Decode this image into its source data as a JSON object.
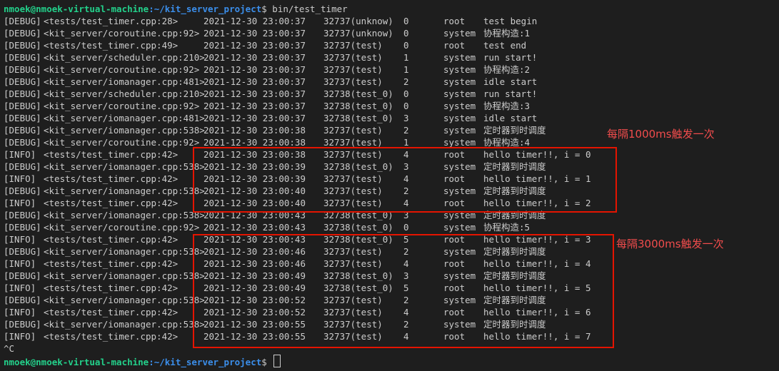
{
  "prompt_top": {
    "user_host": "nmoek@nmoek-virtual-machine",
    "path": ":~/kit_server_project",
    "command": "$ bin/test_timer"
  },
  "log_lines": [
    {
      "level": "[DEBUG]",
      "src": "<tests/test_timer.cpp:28>",
      "time": "2021-12-30 23:00:37",
      "thread": "32737(unknow)",
      "fiber": "0",
      "name": "root",
      "msg": "test begin"
    },
    {
      "level": "[DEBUG]",
      "src": "<kit_server/coroutine.cpp:92>",
      "time": "2021-12-30 23:00:37",
      "thread": "32737(unknow)",
      "fiber": "0",
      "name": "system",
      "msg": "协程构造:1"
    },
    {
      "level": "[DEBUG]",
      "src": "<tests/test_timer.cpp:49>",
      "time": "2021-12-30 23:00:37",
      "thread": "32737(test)",
      "fiber": "0",
      "name": "root",
      "msg": "test end"
    },
    {
      "level": "[DEBUG]",
      "src": "<kit_server/scheduler.cpp:210>",
      "time": "2021-12-30 23:00:37",
      "thread": "32737(test)",
      "fiber": "1",
      "name": "system",
      "msg": "run start!"
    },
    {
      "level": "[DEBUG]",
      "src": "<kit_server/coroutine.cpp:92>",
      "time": "2021-12-30 23:00:37",
      "thread": "32737(test)",
      "fiber": "1",
      "name": "system",
      "msg": "协程构造:2"
    },
    {
      "level": "[DEBUG]",
      "src": "<kit_server/iomanager.cpp:481>",
      "time": "2021-12-30 23:00:37",
      "thread": "32737(test)",
      "fiber": "2",
      "name": "system",
      "msg": "idle start"
    },
    {
      "level": "[DEBUG]",
      "src": "<kit_server/scheduler.cpp:210>",
      "time": "2021-12-30 23:00:37",
      "thread": "32738(test_0)",
      "fiber": "0",
      "name": "system",
      "msg": "run start!"
    },
    {
      "level": "[DEBUG]",
      "src": "<kit_server/coroutine.cpp:92>",
      "time": "2021-12-30 23:00:37",
      "thread": "32738(test_0)",
      "fiber": "0",
      "name": "system",
      "msg": "协程构造:3"
    },
    {
      "level": "[DEBUG]",
      "src": "<kit_server/iomanager.cpp:481>",
      "time": "2021-12-30 23:00:37",
      "thread": "32738(test_0)",
      "fiber": "3",
      "name": "system",
      "msg": "idle start"
    },
    {
      "level": "[DEBUG]",
      "src": "<kit_server/iomanager.cpp:538>",
      "time": "2021-12-30 23:00:38",
      "thread": "32737(test)",
      "fiber": "2",
      "name": "system",
      "msg": "定时器到时调度"
    },
    {
      "level": "[DEBUG]",
      "src": "<kit_server/coroutine.cpp:92>",
      "time": "2021-12-30 23:00:38",
      "thread": "32737(test)",
      "fiber": "1",
      "name": "system",
      "msg": "协程构造:4"
    },
    {
      "level": "[INFO]",
      "src": "<tests/test_timer.cpp:42>",
      "time": "2021-12-30 23:00:38",
      "thread": "32737(test)",
      "fiber": "4",
      "name": "root",
      "msg": "hello timer!!, i = 0"
    },
    {
      "level": "[DEBUG]",
      "src": "<kit_server/iomanager.cpp:538>",
      "time": "2021-12-30 23:00:39",
      "thread": "32738(test_0)",
      "fiber": "3",
      "name": "system",
      "msg": "定时器到时调度"
    },
    {
      "level": "[INFO]",
      "src": "<tests/test_timer.cpp:42>",
      "time": "2021-12-30 23:00:39",
      "thread": "32737(test)",
      "fiber": "4",
      "name": "root",
      "msg": "hello timer!!, i = 1"
    },
    {
      "level": "[DEBUG]",
      "src": "<kit_server/iomanager.cpp:538>",
      "time": "2021-12-30 23:00:40",
      "thread": "32737(test)",
      "fiber": "2",
      "name": "system",
      "msg": "定时器到时调度"
    },
    {
      "level": "[INFO]",
      "src": "<tests/test_timer.cpp:42>",
      "time": "2021-12-30 23:00:40",
      "thread": "32737(test)",
      "fiber": "4",
      "name": "root",
      "msg": "hello timer!!, i = 2"
    },
    {
      "level": "[DEBUG]",
      "src": "<kit_server/iomanager.cpp:538>",
      "time": "2021-12-30 23:00:43",
      "thread": "32738(test_0)",
      "fiber": "3",
      "name": "system",
      "msg": "定时器到时调度"
    },
    {
      "level": "[DEBUG]",
      "src": "<kit_server/coroutine.cpp:92>",
      "time": "2021-12-30 23:00:43",
      "thread": "32738(test_0)",
      "fiber": "0",
      "name": "system",
      "msg": "协程构造:5"
    },
    {
      "level": "[INFO]",
      "src": "<tests/test_timer.cpp:42>",
      "time": "2021-12-30 23:00:43",
      "thread": "32738(test_0)",
      "fiber": "5",
      "name": "root",
      "msg": "hello timer!!, i = 3"
    },
    {
      "level": "[DEBUG]",
      "src": "<kit_server/iomanager.cpp:538>",
      "time": "2021-12-30 23:00:46",
      "thread": "32737(test)",
      "fiber": "2",
      "name": "system",
      "msg": "定时器到时调度"
    },
    {
      "level": "[INFO]",
      "src": "<tests/test_timer.cpp:42>",
      "time": "2021-12-30 23:00:46",
      "thread": "32737(test)",
      "fiber": "4",
      "name": "root",
      "msg": "hello timer!!, i = 4"
    },
    {
      "level": "[DEBUG]",
      "src": "<kit_server/iomanager.cpp:538>",
      "time": "2021-12-30 23:00:49",
      "thread": "32738(test_0)",
      "fiber": "3",
      "name": "system",
      "msg": "定时器到时调度"
    },
    {
      "level": "[INFO]",
      "src": "<tests/test_timer.cpp:42>",
      "time": "2021-12-30 23:00:49",
      "thread": "32738(test_0)",
      "fiber": "5",
      "name": "root",
      "msg": "hello timer!!, i = 5"
    },
    {
      "level": "[DEBUG]",
      "src": "<kit_server/iomanager.cpp:538>",
      "time": "2021-12-30 23:00:52",
      "thread": "32737(test)",
      "fiber": "2",
      "name": "system",
      "msg": "定时器到时调度"
    },
    {
      "level": "[INFO]",
      "src": "<tests/test_timer.cpp:42>",
      "time": "2021-12-30 23:00:52",
      "thread": "32737(test)",
      "fiber": "4",
      "name": "root",
      "msg": "hello timer!!, i = 6"
    },
    {
      "level": "[DEBUG]",
      "src": "<kit_server/iomanager.cpp:538>",
      "time": "2021-12-30 23:00:55",
      "thread": "32737(test)",
      "fiber": "2",
      "name": "system",
      "msg": "定时器到时调度"
    },
    {
      "level": "[INFO]",
      "src": "<tests/test_timer.cpp:42>",
      "time": "2021-12-30 23:00:55",
      "thread": "32737(test)",
      "fiber": "4",
      "name": "root",
      "msg": "hello timer!!, i = 7"
    }
  ],
  "interrupt": "^C",
  "prompt_bottom": {
    "user_host": "nmoek@nmoek-virtual-machine",
    "path": ":~/kit_server_project",
    "command": "$ "
  },
  "annotations": {
    "box1": "每隔1000ms触发一次",
    "box2": "每隔3000ms触发一次"
  },
  "colors": {
    "background": "#1e1e1e",
    "text": "#cccccc",
    "prompt_user": "#23d18b",
    "prompt_path": "#3b8eea",
    "highlight": "#e51400"
  }
}
